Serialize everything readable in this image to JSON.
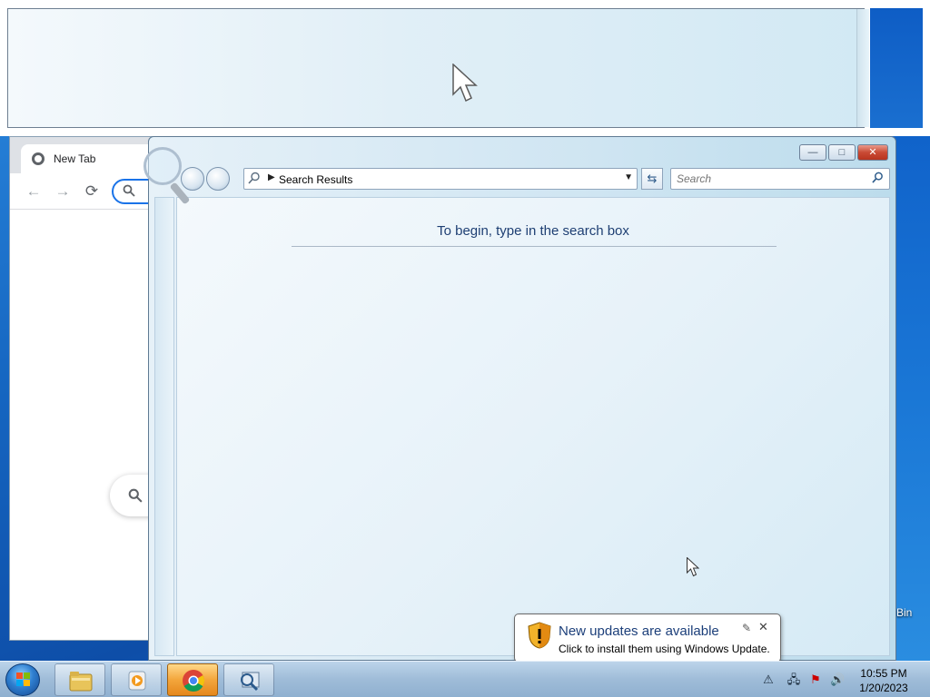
{
  "desktop": {
    "recycle_bin_label": "Bin"
  },
  "chrome": {
    "tab_title": "New Tab",
    "back_icon": "←",
    "forward_icon": "→",
    "reload_icon": "⟳",
    "search_icon": "🔍"
  },
  "explorer": {
    "address_text": "Search Results",
    "search_placeholder": "Search",
    "hint_text": "To begin, type in the search box",
    "minimize_label": "—",
    "maximize_label": "□",
    "close_label": "✕"
  },
  "notification": {
    "title": "New updates are available",
    "body": "Click to install them using Windows Update."
  },
  "taskbar": {
    "time": "10:55 PM",
    "date": "1/20/2023"
  }
}
